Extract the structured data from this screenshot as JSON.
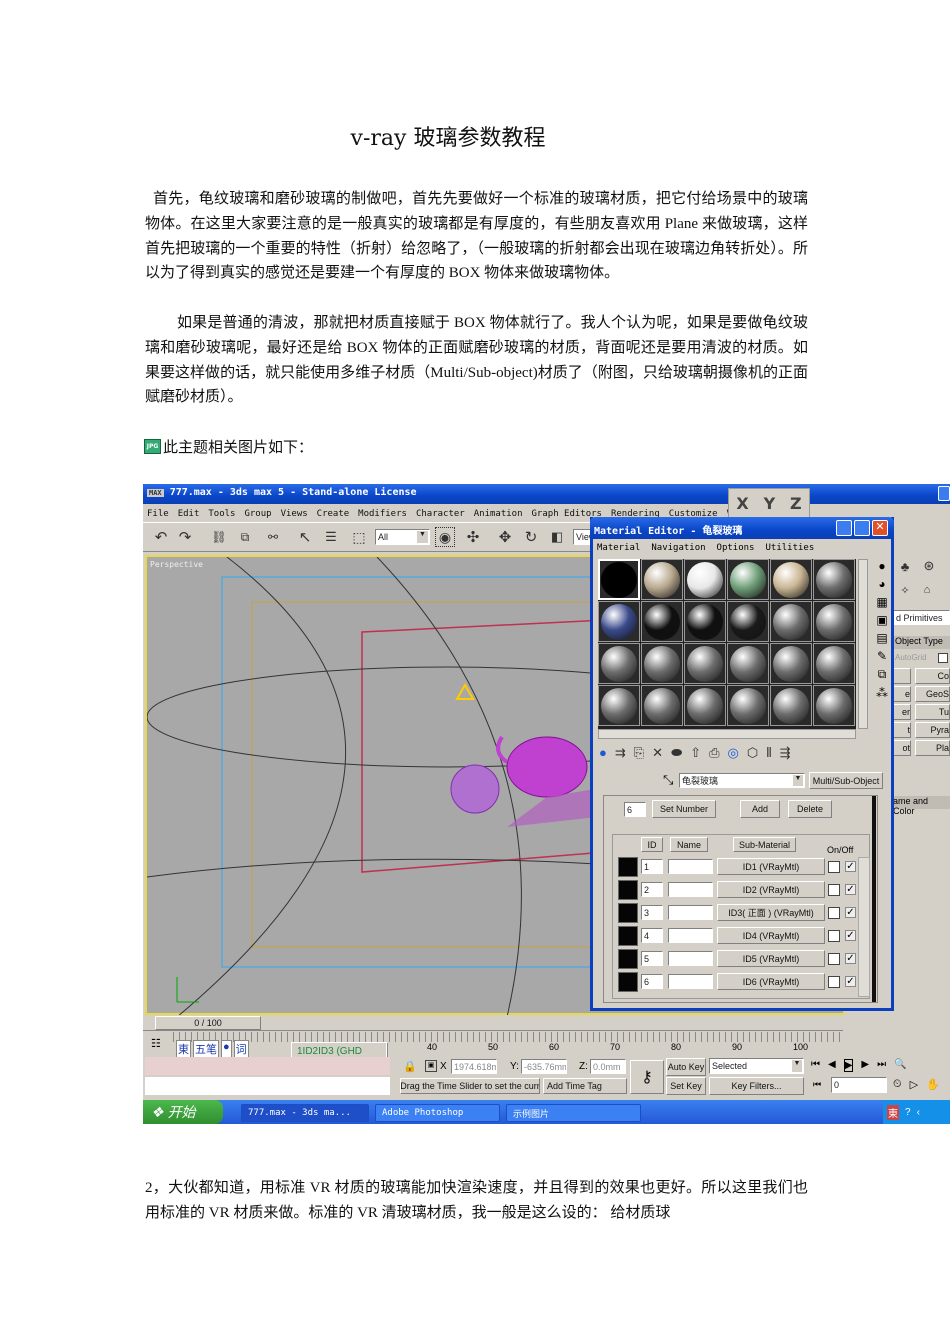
{
  "doc": {
    "title": "v-ray  玻璃参数教程",
    "p1": "首先，龟纹玻璃和磨砂玻璃的制做吧，首先先要做好一个标准的玻璃材质，把它付给场景中的玻璃物体。在这里大家要注意的是一般真实的玻璃都是有厚度的，有些朋友喜欢用 Plane 来做玻璃，这样首先把玻璃的一个重要的特性（折射）给忽略了，（一般玻璃的折射都会出现在玻璃边角转折处）。所以为了得到真实的感觉还是要建一个有厚度的 BOX 物体来做玻璃物体。",
    "p2": "如果是普通的清波，那就把材质直接赋于 BOX 物体就行了。我人个认为呢，如果是要做龟纹玻璃和磨砂玻璃呢，最好还是给 BOX 物体的正面赋磨砂玻璃的材质，背面呢还是要用清波的材质。如果要这样做的话，就只能使用多维子材质（Multi/Sub-object)材质了（附图，只给玻璃朝摄像机的正面赋磨砂材质）。",
    "caption_icon": "JPG",
    "caption": "此主题相关图片如下：",
    "p3": "2，大伙都知道，用标准 VR 材质的玻璃能加快渲染速度，并且得到的效果也更好。所以这里我们也用标准的 VR 材质来做。标准的 VR 清玻璃材质，我一般是这么设的：  给材质球"
  },
  "app": {
    "title": "777.max - 3ds max 5 - Stand-alone License",
    "menu": [
      "File",
      "Edit",
      "Tools",
      "Group",
      "Views",
      "Create",
      "Modifiers",
      "Character",
      "Animation",
      "Graph Editors",
      "Rendering",
      "Customize",
      "VIZ"
    ],
    "selection_filter": "All",
    "view_dropdown": "View",
    "axis": [
      "X",
      "Y",
      "Z"
    ],
    "viewport_label": "Perspective",
    "command_panel": {
      "category": "d Primitives",
      "rollout_object_type": "Object Type",
      "autogrid": "AutoGrid",
      "buttons": [
        "Co",
        "GeoS",
        "Tu",
        "Pyra",
        "Pla"
      ],
      "left_buttons": [
        "",
        "e",
        "er",
        "t",
        "ot"
      ],
      "rollout_name_color": "ame and Color"
    },
    "time_slider": "0 / 100",
    "ruler_ticks": [
      "40",
      "50",
      "60",
      "70",
      "80",
      "90",
      "100"
    ],
    "ime": {
      "items": [
        "東",
        "五笔",
        "●",
        "词"
      ]
    },
    "script_box": "1ID2ID3 (GHD",
    "coords": {
      "x": "1974.618m",
      "y": "-635.76mm",
      "z": "0.0mm",
      "x_label": "X",
      "y_label": "Y:",
      "z_label": "Z:"
    },
    "status_prompt": "Drag the Time Slider to set the curr",
    "add_time_tag": "Add Time Tag",
    "auto_key": "Auto Key",
    "set_key": "Set Key",
    "key_mode": "Selected",
    "key_filters": "Key Filters...",
    "frame": "0"
  },
  "material_editor": {
    "title": "Material Editor - 龟裂玻璃",
    "menu": [
      "Material",
      "Navigation",
      "Options",
      "Utilities"
    ],
    "slot_colors": [
      "#000000",
      "#b9a98f",
      "#e8e8e8",
      "#6f9f78",
      "#c9b592",
      "#6d6d6d",
      "#3a4a8a",
      "#101010",
      "#101010",
      "#1a1a1a",
      "#6d6d6d",
      "#6d6d6d",
      "#6d6d6d",
      "#6d6d6d",
      "#6d6d6d",
      "#6d6d6d",
      "#6d6d6d",
      "#6d6d6d",
      "#6d6d6d",
      "#6d6d6d",
      "#6d6d6d",
      "#6d6d6d",
      "#6d6d6d",
      "#6d6d6d"
    ],
    "material_name": "龟裂玻璃",
    "material_type": "Multi/Sub-Object",
    "count": "6",
    "set_number": "Set Number",
    "add": "Add",
    "delete": "Delete",
    "headers": {
      "id": "ID",
      "name": "Name",
      "sub": "Sub-Material",
      "onoff": "On/Off"
    },
    "rows": [
      {
        "id": "1",
        "name": "",
        "sub": "ID1 (VRayMtl)",
        "on": true
      },
      {
        "id": "2",
        "name": "",
        "sub": "ID2 (VRayMtl)",
        "on": true
      },
      {
        "id": "3",
        "name": "",
        "sub": "ID3( 正面 ) (VRayMtl)",
        "on": true
      },
      {
        "id": "4",
        "name": "",
        "sub": "ID4 (VRayMtl)",
        "on": true
      },
      {
        "id": "5",
        "name": "",
        "sub": "ID5 (VRayMtl)",
        "on": true
      },
      {
        "id": "6",
        "name": "",
        "sub": "ID6 (VRayMtl)",
        "on": true
      }
    ]
  },
  "taskbar": {
    "start": "开始",
    "items": [
      "777.max - 3ds ma...",
      "Adobe Photoshop",
      "示例图片"
    ]
  }
}
